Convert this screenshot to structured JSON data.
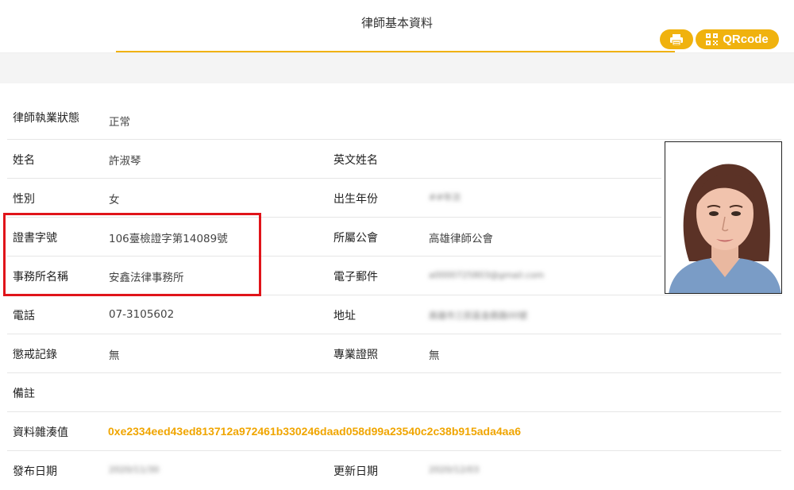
{
  "header": {
    "title": "律師基本資料",
    "qr_label": "QRcode",
    "print_icon": "printer-icon",
    "qr_icon": "qrcode-icon",
    "accent_color": "#f0b20e"
  },
  "status": {
    "label": "律師執業狀態",
    "value": "正常"
  },
  "fields": {
    "name": {
      "label": "姓名",
      "value": "許淑琴"
    },
    "english_name": {
      "label": "英文姓名",
      "value": ""
    },
    "gender": {
      "label": "性別",
      "value": "女"
    },
    "birth_year": {
      "label": "出生年份",
      "value": "##年次"
    },
    "certificate": {
      "label": "證書字號",
      "value": "106臺檢證字第14089號"
    },
    "bar_association": {
      "label": "所屬公會",
      "value": "高雄律師公會"
    },
    "firm_name": {
      "label": "事務所名稱",
      "value": "安鑫法律事務所"
    },
    "email": {
      "label": "電子郵件",
      "value": "a0000725803@gmail.com"
    },
    "phone": {
      "label": "電話",
      "value": "07-3105602"
    },
    "address": {
      "label": "地址",
      "value": "高雄市三民區金鼎路00號"
    },
    "discipline": {
      "label": "懲戒記錄",
      "value": "無"
    },
    "specialty_cert": {
      "label": "專業證照",
      "value": "無"
    },
    "remarks": {
      "label": "備註",
      "value": ""
    },
    "data_hash": {
      "label": "資料雜湊值",
      "value": "0xe2334eed43ed813712a972461b330246daad058d99a23540c2c38b915ada4aa6"
    },
    "publish_date": {
      "label": "發布日期",
      "value": "2020/11/30"
    },
    "update_date": {
      "label": "更新日期",
      "value": "2020/12/03"
    }
  },
  "highlight_color": "#e0141a"
}
